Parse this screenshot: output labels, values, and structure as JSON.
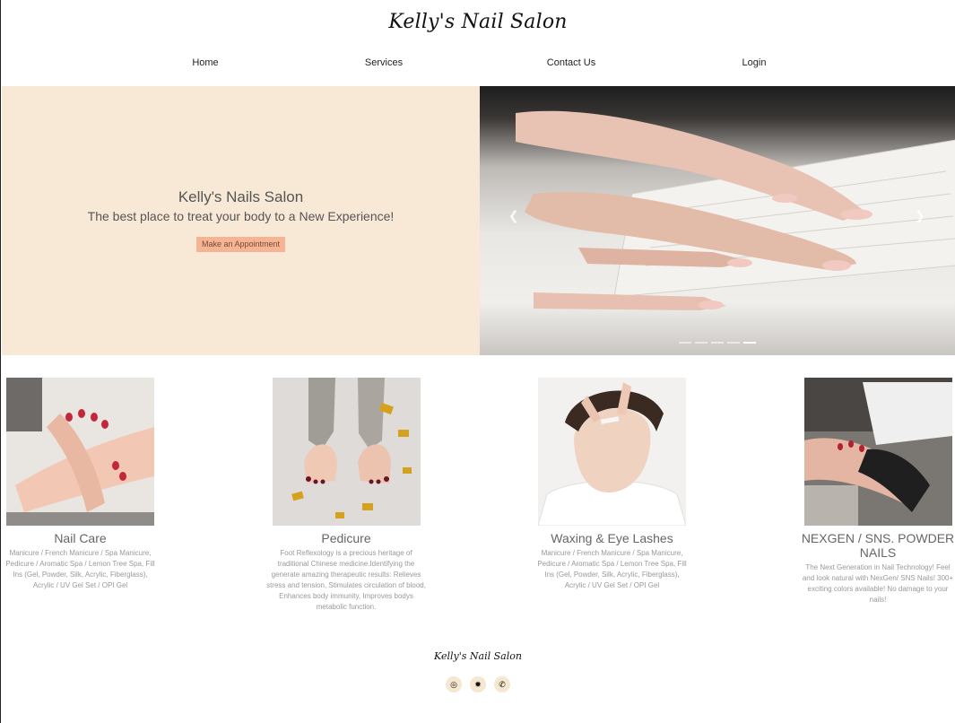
{
  "brand": "Kelly's Nail Salon",
  "nav": [
    "Home",
    "Services",
    "Contact Us",
    "Login"
  ],
  "hero": {
    "title": "Kelly's Nails Salon",
    "subtitle": "The best place to treat your body to a New Experience!",
    "cta": "Make an Appointment",
    "prev_icon": "chevron-left-icon",
    "next_icon": "chevron-right-icon",
    "slide_count": 5,
    "active_slide": 5
  },
  "services": [
    {
      "title": "Nail Care",
      "desc": "Manicure / French Manicure / Spa Manicure, Pedicure / Aromatic Spa / Lemon Tree Spa, Fill Ins (Gel, Powder, Silk, Acrylic, Fiberglass), Acrylic / UV Gel Set / OPI Gel"
    },
    {
      "title": "Pedicure",
      "desc": "Foot Reflexology is a precious heritage of traditional Chinese medicine.Identifying the generate amazing therapeutic results: Relieves stress and tension, Stimulates circulation of blood, Enhances body immunity, Improves bodys metabolic function."
    },
    {
      "title": "Waxing & Eye Lashes",
      "desc": "Manicure / French Manicure / Spa Manicure, Pedicure / Aromatic Spa / Lemon Tree Spa, Fill Ins (Gel, Powder, Silk, Acrylic, Fiberglass), Acrylic / UV Gel Set / OPI Gel"
    },
    {
      "title": "NEXGEN / SNS. POWDER NAILS",
      "desc": "The Next Generation in Nail Technology! Feel and look natural with NexGen/ SNS Nails! 300+ exciting colors available! No damage to your nails!"
    }
  ],
  "footer": {
    "brand": "Kelly's Nail Salon",
    "social_icons": [
      "instagram-icon",
      "yelp-icon",
      "phone-icon"
    ]
  },
  "colors": {
    "hero_bg": "#f8e9d6",
    "cta_bg": "#f5b493",
    "social_bg": "#f5e7d0"
  }
}
